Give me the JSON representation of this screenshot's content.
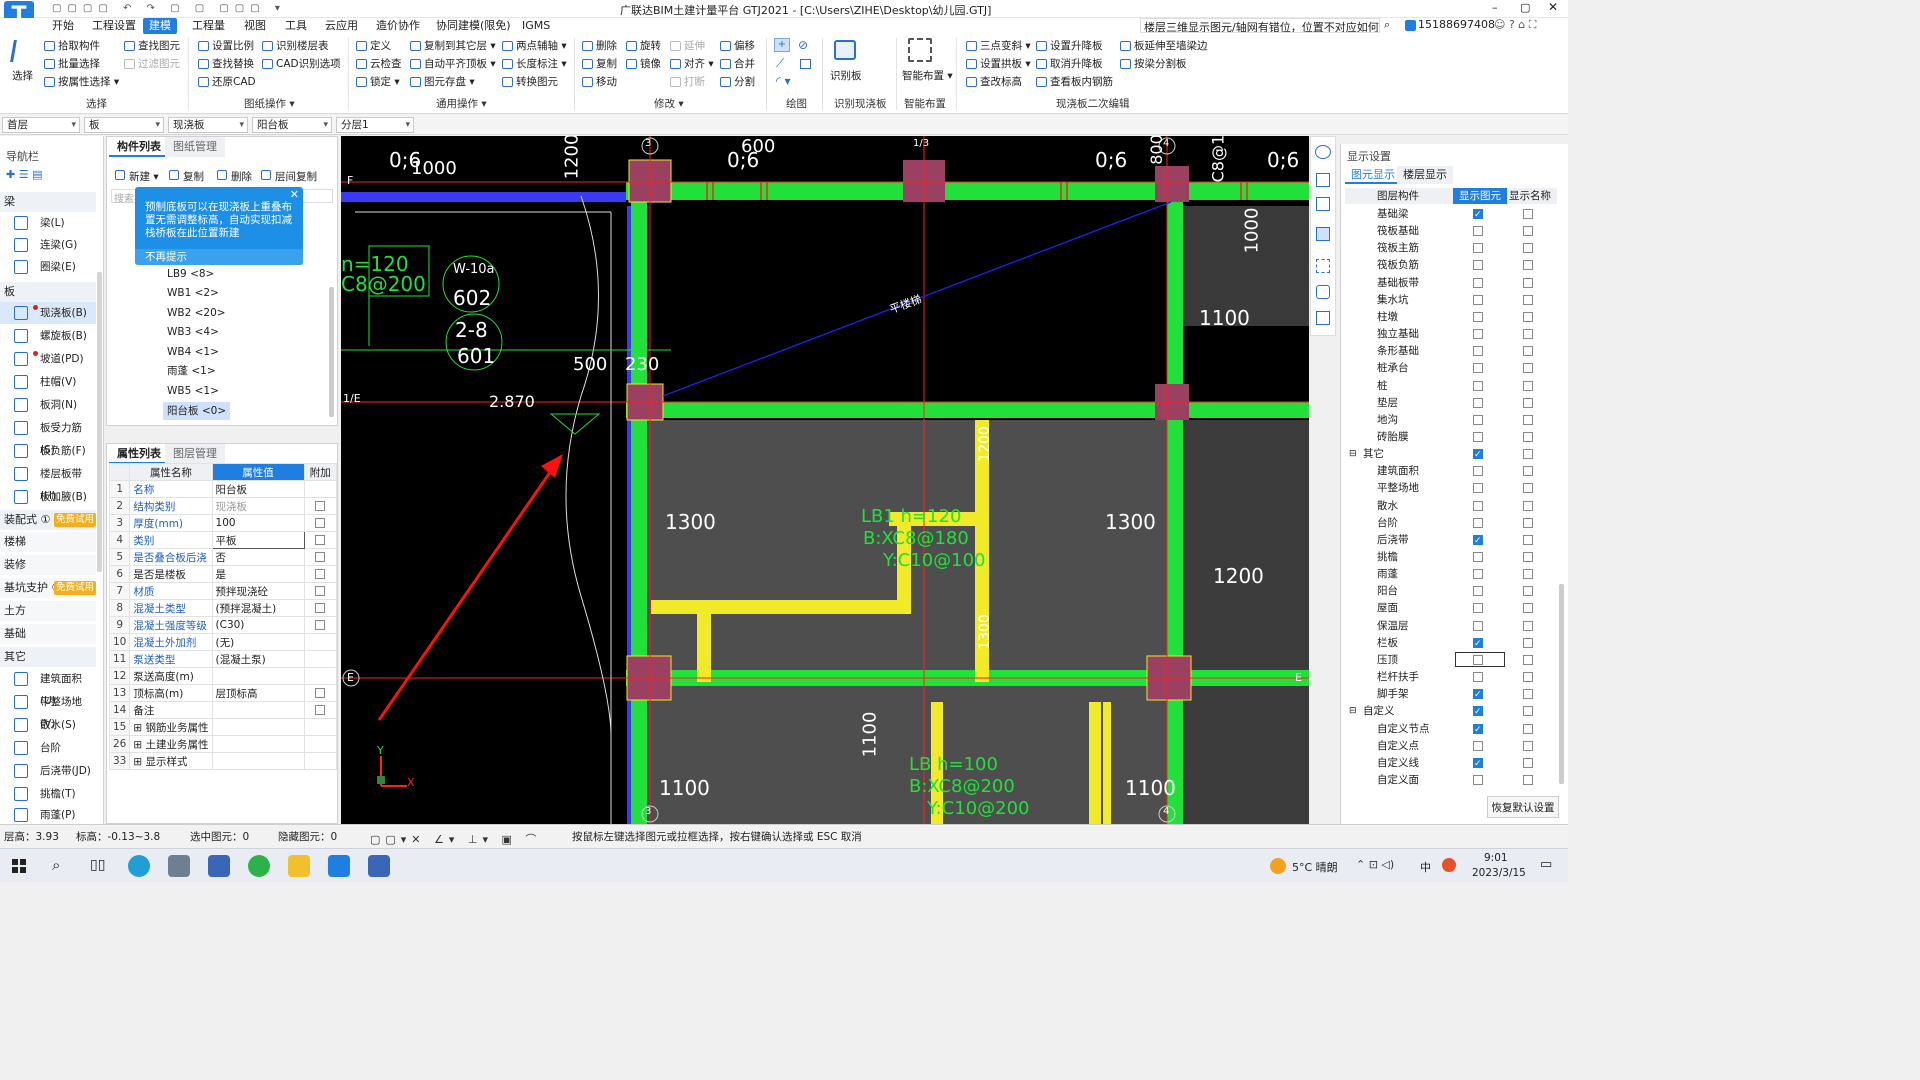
{
  "title": {
    "center": "广联达BIM土建计量平台 GTJ2021 - [C:\\Users\\ZIHE\\Desktop\\幼儿园.GTJ]",
    "question": "楼层三维显示图元/轴网有错位，位置不对应如何处理？",
    "account": "15188697408"
  },
  "menu": [
    "开始",
    "工程设置",
    "建模",
    "工程量",
    "视图",
    "工具",
    "云应用",
    "造价协作",
    "协同建模(限免)",
    "IGMS"
  ],
  "ribbon": {
    "select": {
      "big": "选择",
      "items": [
        "拾取构件",
        "批量选择",
        "按属性选择",
        "查找图元",
        "过滤图元"
      ],
      "group": "选择"
    },
    "cad": {
      "items": [
        "设置比例",
        "识别楼层表",
        "查找替换",
        "CAD识别选项",
        "还原CAD"
      ],
      "group": "图纸操作"
    },
    "common": {
      "items": [
        "定义",
        "复制到其它层",
        "两点辅轴",
        "云检查",
        "自动平齐顶板",
        "长度标注",
        "锁定",
        "图元存盘",
        "转换图元"
      ],
      "group": "通用操作"
    },
    "modify": {
      "items": [
        "删除",
        "旋转",
        "延伸",
        "偏移",
        "复制",
        "镜像",
        "对齐",
        "合并",
        "移动",
        "打断",
        "分割"
      ],
      "group": "修改"
    },
    "draw": {
      "group": "绘图"
    },
    "recog": {
      "big": "识别板",
      "group": "识别现浇板"
    },
    "smart": {
      "big": "智能布置",
      "group": "智能布置"
    },
    "edit2": {
      "items": [
        "三点变斜",
        "设置升降板",
        "板延伸至墙梁边",
        "设置拱板",
        "取消升降板",
        "按梁分割板",
        "查改标高",
        "查看板内钢筋"
      ],
      "group": "现浇板二次编辑"
    }
  },
  "filters": [
    "首层",
    "板",
    "现浇板",
    "阳台板",
    "分层1"
  ],
  "nav": {
    "title": "导航栏",
    "sections": {
      "beam": "梁",
      "slab": "板",
      "assembly": "装配式 ①",
      "stair": "楼梯",
      "decor": "装修",
      "pit": "基坑支护 ①",
      "earth": "土方",
      "found": "基础",
      "other": "其它"
    },
    "beam_items": [
      "梁(L)",
      "连梁(G)",
      "圈梁(E)"
    ],
    "slab_items": [
      "现浇板(B)",
      "螺旋板(B)",
      "坡道(PD)",
      "柱帽(V)",
      "板洞(N)",
      "板受力筋(S)",
      "板负筋(F)",
      "楼层板带(H)",
      "板加腋(B)"
    ],
    "other_items": [
      "建筑面积(U)",
      "平整场地(V)",
      "散水(S)",
      "台阶",
      "后浇带(JD)",
      "挑檐(T)",
      "雨蓬(P)"
    ],
    "trial": "免费试用"
  },
  "components": {
    "tabs": [
      "构件列表",
      "图纸管理"
    ],
    "toolbar": [
      "新建",
      "复制",
      "删除",
      "层间复制"
    ],
    "search": "搜索构",
    "tip": "预制底板可以在现浇板上重叠布置无需调整标高，自动实现扣减栈桥板在此位置新建",
    "tip_close": "不再提示",
    "items": [
      "LB9 <8>",
      "WB1 <2>",
      "WB2 <20>",
      "WB3 <4>",
      "WB4 <1>",
      "雨蓬 <1>",
      "WB5 <1>",
      "阳台板 <0>"
    ]
  },
  "properties": {
    "tabs": [
      "属性列表",
      "图层管理"
    ],
    "headers": [
      "属性名称",
      "属性值",
      "附加"
    ],
    "rows": [
      {
        "n": "1",
        "name": "名称",
        "value": "阳台板",
        "blue": true,
        "cb": null
      },
      {
        "n": "2",
        "name": "结构类别",
        "value": "现浇板",
        "blue": true,
        "cb": false,
        "gray": true
      },
      {
        "n": "3",
        "name": "厚度(mm)",
        "value": "100",
        "blue": true,
        "cb": false
      },
      {
        "n": "4",
        "name": "类别",
        "value": "平板",
        "blue": true,
        "cb": false
      },
      {
        "n": "5",
        "name": "是否叠合板后浇",
        "value": "否",
        "blue": true,
        "cb": false
      },
      {
        "n": "6",
        "name": "是否是楼板",
        "value": "是",
        "blue": false,
        "cb": false
      },
      {
        "n": "7",
        "name": "材质",
        "value": "预拌现浇砼",
        "blue": true,
        "cb": false
      },
      {
        "n": "8",
        "name": "混凝土类型",
        "value": "(预拌混凝土)",
        "blue": true,
        "cb": false
      },
      {
        "n": "9",
        "name": "混凝土强度等级",
        "value": "(C30)",
        "blue": true,
        "cb": false
      },
      {
        "n": "10",
        "name": "混凝土外加剂",
        "value": "(无)",
        "blue": true,
        "cb": null
      },
      {
        "n": "11",
        "name": "泵送类型",
        "value": "(混凝土泵)",
        "blue": true,
        "cb": null
      },
      {
        "n": "12",
        "name": "泵送高度(m)",
        "value": "",
        "blue": false,
        "cb": null
      },
      {
        "n": "13",
        "name": "顶标高(m)",
        "value": "层顶标高",
        "blue": false,
        "cb": false
      },
      {
        "n": "14",
        "name": "备注",
        "value": "",
        "blue": false,
        "cb": false
      },
      {
        "n": "15",
        "name": "⊞ 钢筋业务属性",
        "value": "",
        "blue": false,
        "cb": null
      },
      {
        "n": "26",
        "name": "⊞ 土建业务属性",
        "value": "",
        "blue": false,
        "cb": null
      },
      {
        "n": "33",
        "name": "⊞ 显示样式",
        "value": "",
        "blue": false,
        "cb": null
      }
    ]
  },
  "canvas_text": {
    "axes": [
      "3",
      "1/3",
      "4",
      "F",
      "1/E",
      "E",
      "E",
      "3",
      "4"
    ],
    "dims": [
      "0;6",
      "1000",
      "1200",
      "0;6",
      "600",
      "0;6",
      "800",
      "0;6",
      "C8@18",
      "1000",
      "1100",
      "1100",
      "1300",
      "1300",
      "1200",
      "1100",
      "1100",
      "1100",
      "500",
      "230",
      "2.870",
      "1200",
      "1300"
    ],
    "tags": [
      "W-10a",
      "602",
      "2-8",
      "601",
      "n=120",
      "C8@200",
      "LB1 h=120",
      "B:XC8@180",
      "Y:C10@100",
      "LB h=100",
      "B:XC8@200",
      "Y:C10@200",
      "平楼梯"
    ],
    "ucs": [
      "Y",
      "X"
    ]
  },
  "display": {
    "title": "显示设置",
    "tabs": [
      "图元显示",
      "楼层显示"
    ],
    "headers": [
      "图层构件",
      "显示图元",
      "显示名称"
    ],
    "rows": [
      [
        "基础梁",
        true,
        false
      ],
      [
        "筏板基础",
        false,
        false
      ],
      [
        "筏板主筋",
        false,
        false
      ],
      [
        "筏板负筋",
        false,
        false
      ],
      [
        "基础板带",
        false,
        false
      ],
      [
        "集水坑",
        false,
        false
      ],
      [
        "柱墩",
        false,
        false
      ],
      [
        "独立基础",
        false,
        false
      ],
      [
        "条形基础",
        false,
        false
      ],
      [
        "桩承台",
        false,
        false
      ],
      [
        "桩",
        false,
        false
      ],
      [
        "垫层",
        false,
        false
      ],
      [
        "地沟",
        false,
        false
      ],
      [
        "砖胎膜",
        false,
        false
      ],
      [
        "其它",
        true,
        false,
        "g"
      ],
      [
        "建筑面积",
        false,
        false
      ],
      [
        "平整场地",
        false,
        false
      ],
      [
        "散水",
        false,
        false
      ],
      [
        "台阶",
        false,
        false
      ],
      [
        "后浇带",
        true,
        false
      ],
      [
        "挑檐",
        false,
        false
      ],
      [
        "雨蓬",
        false,
        false
      ],
      [
        "阳台",
        false,
        false
      ],
      [
        "屋面",
        false,
        false
      ],
      [
        "保温层",
        false,
        false
      ],
      [
        "栏板",
        true,
        false
      ],
      [
        "压顶",
        false,
        false
      ],
      [
        "栏杆扶手",
        false,
        false
      ],
      [
        "脚手架",
        true,
        false
      ],
      [
        "自定义",
        true,
        false,
        "g"
      ],
      [
        "自定义节点",
        true,
        false
      ],
      [
        "自定义点",
        false,
        false
      ],
      [
        "自定义线",
        true,
        false
      ],
      [
        "自定义面",
        false,
        false
      ]
    ],
    "restore": "恢复默认设置"
  },
  "status": {
    "floor": "层高：3.93",
    "elev": "标高：-0.13~3.8",
    "selected": "选中图元：0",
    "hidden": "隐藏图元：0",
    "hint": "按鼠标左键选择图元或拉框选择，按右键确认选择或 ESC 取消"
  },
  "taskbar": {
    "weather": "5°C 晴朗",
    "ime": "中",
    "time": "9:01",
    "date": "2023/3/15"
  },
  "colors": {
    "accent": "#1f7fe0",
    "beam": "#22e03a",
    "wall": "#f0ea28",
    "column": "#9a4060"
  }
}
